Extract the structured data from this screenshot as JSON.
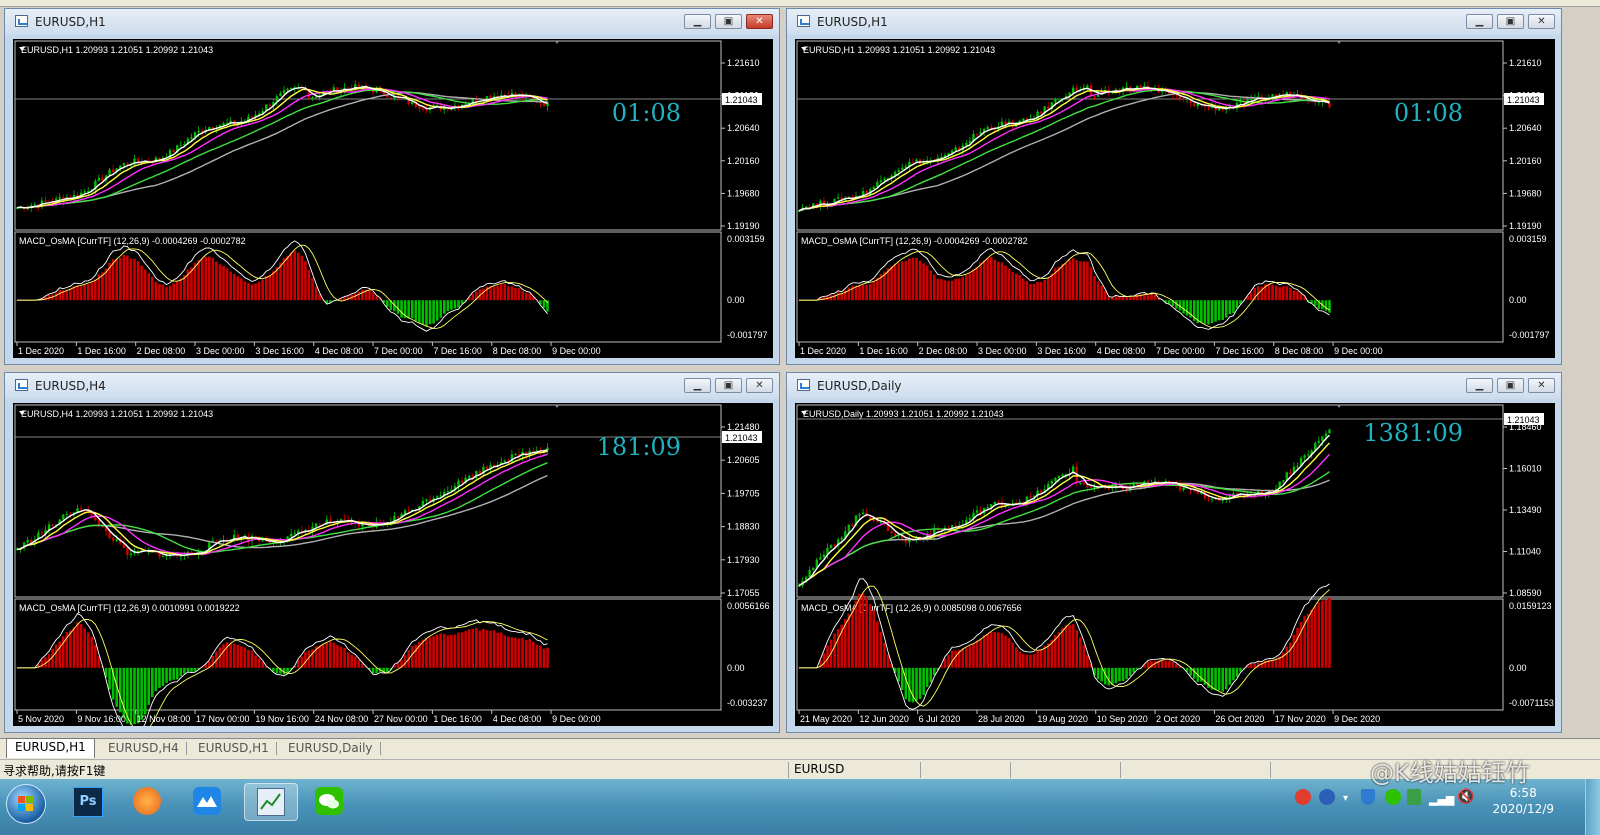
{
  "windows": [
    {
      "title": "EURUSD,H1",
      "info": "EURUSD,H1  1.20993 1.21051 1.20992 1.21043",
      "timer": "01:08",
      "macd_label": "MACD_OsMA [CurrTF] (12,26,9) -0.0004269 -0.0002782",
      "price_ticks": [
        "1.21610",
        "1.21120",
        "1.20640",
        "1.20160",
        "1.19680",
        "1.19190"
      ],
      "current_price": "1.21043",
      "macd_ticks": [
        "0.003159",
        "0.00",
        "-0.001797"
      ],
      "time_ticks": [
        "1 Dec 2020",
        "1 Dec 16:00",
        "2 Dec 08:00",
        "3 Dec 00:00",
        "3 Dec 16:00",
        "4 Dec 08:00",
        "7 Dec 00:00",
        "7 Dec 16:00",
        "8 Dec 08:00",
        "9 Dec 00:00"
      ],
      "active": true
    },
    {
      "title": "EURUSD,H1",
      "info": "EURUSD,H1  1.20993 1.21051 1.20992 1.21043",
      "timer": "01:08",
      "macd_label": "MACD_OsMA [CurrTF] (12,26,9) -0.0004269 -0.0002782",
      "price_ticks": [
        "1.21610",
        "1.21120",
        "1.20640",
        "1.20160",
        "1.19680",
        "1.19190"
      ],
      "current_price": "1.21043",
      "macd_ticks": [
        "0.003159",
        "0.00",
        "-0.001797"
      ],
      "time_ticks": [
        "1 Dec 2020",
        "1 Dec 16:00",
        "2 Dec 08:00",
        "3 Dec 00:00",
        "3 Dec 16:00",
        "4 Dec 08:00",
        "7 Dec 00:00",
        "7 Dec 16:00",
        "8 Dec 08:00",
        "9 Dec 00:00"
      ],
      "active": false
    },
    {
      "title": "EURUSD,H4",
      "info": "EURUSD,H4  1.20993 1.21051 1.20992 1.21043",
      "timer": "181:09",
      "macd_label": "MACD_OsMA [CurrTF] (12,26,9) 0.0010991 0.0019222",
      "price_ticks": [
        "1.21480",
        "1.20605",
        "1.19705",
        "1.18830",
        "1.17930",
        "1.17055"
      ],
      "current_price": "1.21043",
      "macd_ticks": [
        "0.0056166",
        "0.00",
        "-0.003237"
      ],
      "time_ticks": [
        "5 Nov 2020",
        "9 Nov 16:00",
        "12 Nov 08:00",
        "17 Nov 00:00",
        "19 Nov 16:00",
        "24 Nov 08:00",
        "27 Nov 00:00",
        "1 Dec 16:00",
        "4 Dec 08:00",
        "9 Dec 00:00"
      ],
      "active": false
    },
    {
      "title": "EURUSD,Daily",
      "info": "EURUSD,Daily  1.20993 1.21051 1.20992 1.21043",
      "timer": "1381:09",
      "macd_label": "MACD_OsMA [CurrTF] (12,26,9) 0.0085098 0.0067656",
      "price_ticks": [
        "1.18460",
        "1.16010",
        "1.13490",
        "1.11040",
        "1.08590"
      ],
      "current_price": "1.21043",
      "macd_ticks": [
        "0.0159123",
        "0.00",
        "-0.0071153"
      ],
      "time_ticks": [
        "21 May 2020",
        "12 Jun 2020",
        "6 Jul 2020",
        "28 Jul 2020",
        "19 Aug 2020",
        "10 Sep 2020",
        "2 Oct 2020",
        "26 Oct 2020",
        "17 Nov 2020",
        "9 Dec 2020"
      ],
      "active": false
    }
  ],
  "tabs": [
    "EURUSD,H1",
    "EURUSD,H4",
    "EURUSD,H1",
    "EURUSD,Daily"
  ],
  "status": {
    "help": "寻求帮助,请按F1键",
    "symbol": "EURUSD"
  },
  "taskbar": {
    "time": "6:58",
    "date": "2020/12/9",
    "watermark": "@K线姑姑钰竹"
  },
  "colors": {
    "chart_bg": "#000000",
    "bull": "#00c000",
    "bear": "#d00000",
    "timer": "#20b2c0",
    "ma_fast": "#ffffff",
    "ma_2": "#ffff40",
    "ma_3": "#ff30ff",
    "ma_4": "#40e040",
    "ma_5": "#b0b0b0"
  }
}
